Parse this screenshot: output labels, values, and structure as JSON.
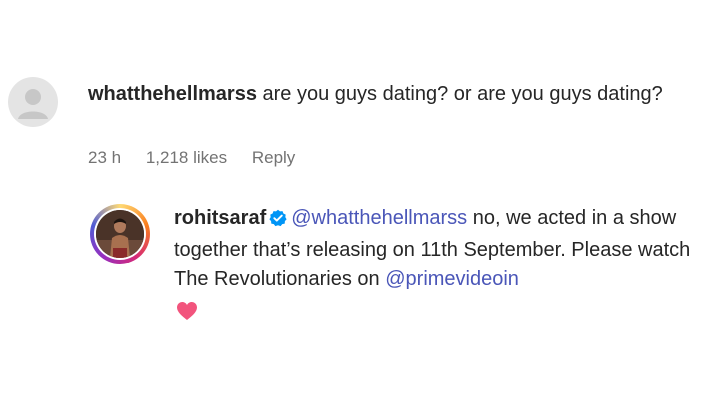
{
  "comment": {
    "username": "whatthehellmarss",
    "text": " are you guys dating? or are you guys dating?",
    "time": "23 h",
    "likes": "1,218 likes",
    "reply_label": "Reply"
  },
  "reply": {
    "username": "rohitsaraf",
    "mention": "@whatthehellmarss",
    "text_main": " no, we acted in a show together that’s releasing on 11th September. Please watch The Revolutionaries on ",
    "mention2": "@primevideoin"
  },
  "colors": {
    "verified": "#0095f6",
    "mention": "#4a56b8",
    "heart": "#f2547d",
    "meta": "#737373"
  }
}
